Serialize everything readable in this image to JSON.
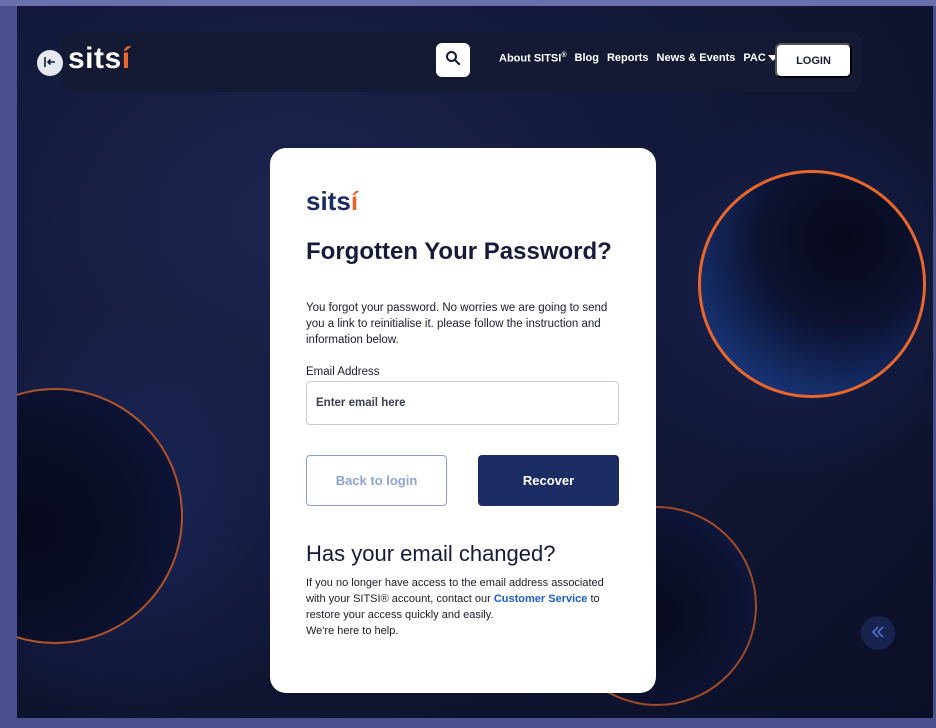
{
  "nav": {
    "logo": "sits",
    "logo_accent": "í",
    "links": [
      "About SITSI",
      "Blog",
      "Reports",
      "News & Events",
      "PAC"
    ],
    "about_sup": "®",
    "login_label": "LOGIN"
  },
  "card": {
    "logo": "sits",
    "logo_accent": "í",
    "title": "Forgotten Your Password?",
    "description": "You forgot your password. No worries we are going to send you a link to reinitialise it. please follow the instruction and information below.",
    "email_label": "Email Address",
    "email_placeholder": "Enter email here",
    "back_label": "Back to login",
    "recover_label": "Recover",
    "changed_title": "Has your email changed?",
    "changed_text_1": "If you no longer have access to the email address associated with your SITSI® account, contact our ",
    "changed_link": "Customer Service",
    "changed_text_2": " to restore your access quickly and easily.",
    "changed_text_3": "We're here to help."
  },
  "colors": {
    "accent": "#e8662a",
    "primary": "#1c2d66",
    "link": "#1b5fc9"
  },
  "icons": {
    "logout": "logout-icon",
    "search": "search-icon",
    "caret": "caret-down-icon",
    "scroll": "double-chevron-left-icon"
  }
}
